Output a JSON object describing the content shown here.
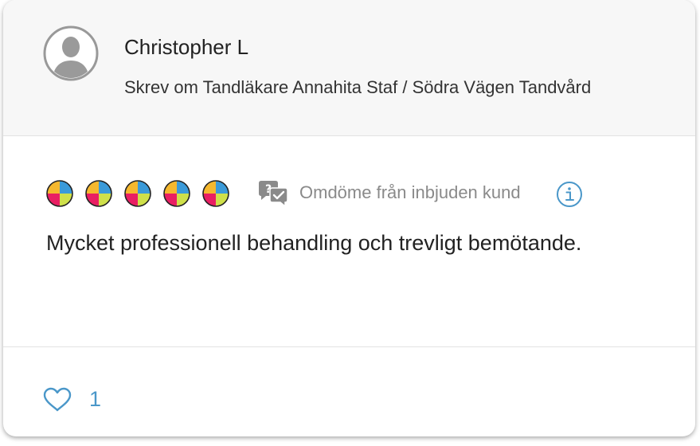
{
  "review": {
    "reviewer_name": "Christopher L",
    "subtitle": "Skrev om Tandläkare Annahita Staf / Södra Vägen Tandvård",
    "rating": 5,
    "rating_max": 5,
    "invited_label": "Omdöme från inbjuden kund",
    "text": "Mycket professionell behandling och trevligt bemötande.",
    "like_count": "1"
  },
  "icons": {
    "avatar": "user-avatar-icon",
    "rating": "rating-dot-icon",
    "invited": "chat-bubbles-check-icon",
    "info": "info-icon",
    "like": "heart-icon"
  },
  "colors": {
    "rating_quadrants": [
      "#3a9ad9",
      "#cfe04a",
      "#e91e63",
      "#f5b82e"
    ],
    "accent": "#4a97c9",
    "muted": "#8a8a8a"
  }
}
